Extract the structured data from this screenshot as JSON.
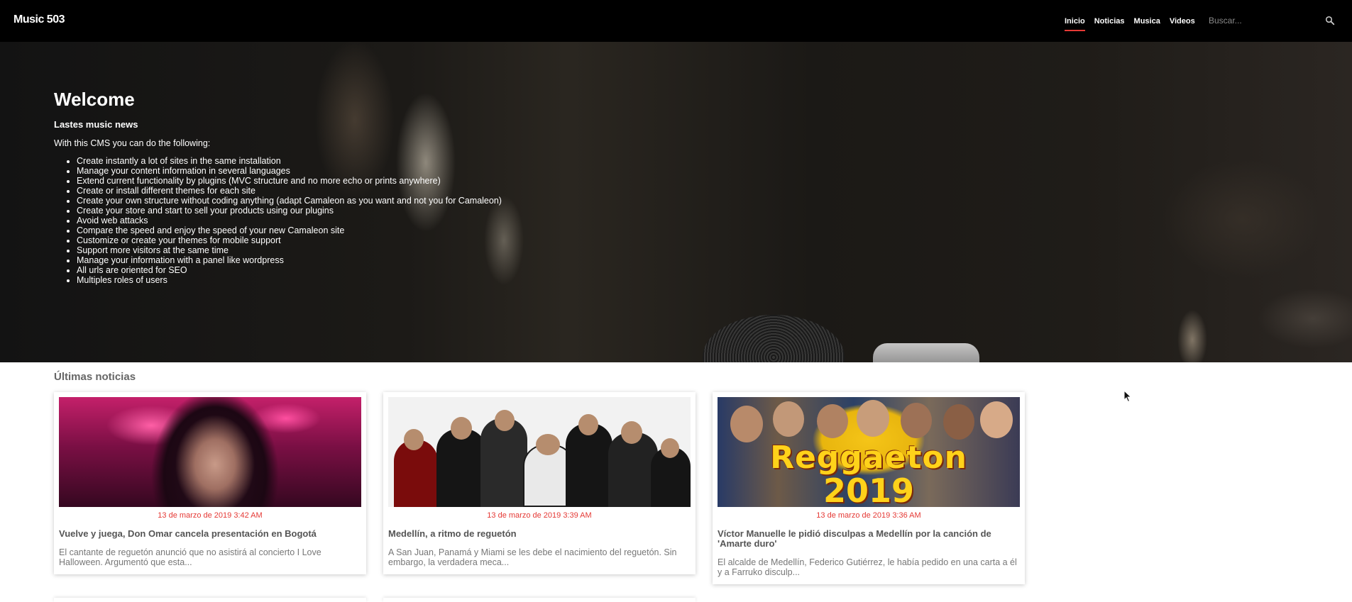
{
  "navbar": {
    "brand": "Music 503",
    "links": [
      {
        "label": "Inicio",
        "active": true
      },
      {
        "label": "Noticias",
        "active": false
      },
      {
        "label": "Musica",
        "active": false
      },
      {
        "label": "Videos",
        "active": false
      }
    ],
    "search_placeholder": "Buscar...",
    "search_icon": "search-icon",
    "accent_color": "#e53935"
  },
  "hero": {
    "title": "Welcome",
    "subtitle": "Lastes music news",
    "intro": "With this CMS you can do the following:",
    "features": [
      "Create instantly a lot of sites in the same installation",
      "Manage your content information in several languages",
      "Extend current functionality by plugins (MVC structure and no more echo or prints anywhere)",
      "Create or install different themes for each site",
      "Create your own structure without coding anything (adapt Camaleon as you want and not you for Camaleon)",
      "Create your store and start to sell your products using our plugins",
      "Avoid web attacks",
      "Compare the speed and enjoy the speed of your new Camaleon site",
      "Customize or create your themes for mobile support",
      "Support more visitors at the same time",
      "Manage your information with a panel like wordpress",
      "All urls are oriented for SEO",
      "Multiples roles of users"
    ]
  },
  "news": {
    "heading": "Últimas noticias",
    "cards": [
      {
        "date": "13 de marzo de 2019 3:42 AM",
        "title": "Vuelve y juega, Don Omar cancela presentación en Bogotá",
        "excerpt": "El cantante de reguetón anunció que no asistirá al concierto I Love Halloween. Argumentó que esta..."
      },
      {
        "date": "13 de marzo de 2019 3:39 AM",
        "title": "Medellín, a ritmo de reguetón",
        "excerpt": "A San Juan, Panamá y Miami se les debe el nacimiento del reguetón. Sin embargo, la verdadera meca..."
      },
      {
        "date": "13 de marzo de 2019 3:36 AM",
        "title": "Víctor Manuelle le pidió disculpas a Medellín por la canción de 'Amarte duro'",
        "excerpt": "El alcalde de Medellín, Federico Gutiérrez, le había pedido en una carta a él y a Farruko disculp...",
        "image_text": "Reggaeton",
        "image_year": "2019"
      }
    ]
  }
}
